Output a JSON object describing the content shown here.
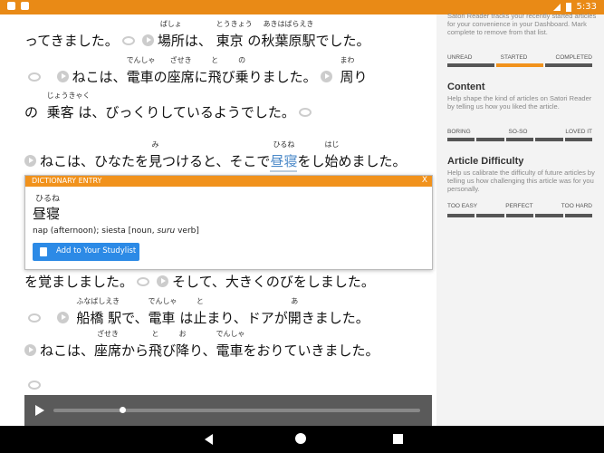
{
  "status": {
    "time": "5:33"
  },
  "lines": {
    "l1": {
      "a": "ってきました。",
      "b1": "場所",
      "b1r": "ばしょ",
      "c": "は、",
      "b2": "東京",
      "b2r": "とうきょう",
      "d": "の",
      "b3": "秋葉原駅",
      "b3r": "あきはばらえき",
      "e": "でした。"
    },
    "l2": {
      "a": "ねこは、",
      "b1": "電車",
      "b1r": "でんしゃ",
      "c": "の",
      "b2": "座席",
      "b2r": "ざせき",
      "d": "に",
      "b3": "飛",
      "b3r": "と",
      "e": "び",
      "b4": "乗",
      "b4r": "の",
      "f": "りました。",
      "b5": "周",
      "b5r": "まわ",
      "g": "り"
    },
    "l3": {
      "a": "の",
      "b1": "乗客",
      "b1r": "じょうきゃく",
      "c": "は、びっくりしているようでした。"
    },
    "l4": {
      "a": "ねこは、ひなたを",
      "b1": "見",
      "b1r": "み",
      "c": "つけると、そこで",
      "b2": "昼寝",
      "b2r": "ひるね",
      "d": "をし",
      "b3": "始",
      "b3r": "はじ",
      "e": "めました。"
    },
    "l5": {
      "a": "を覚ましました。",
      "b": "そして、大きくのびをしました。"
    },
    "l6": {
      "b1": "船橋",
      "b1r": "ふなばしえき",
      "a": "駅で、",
      "b2": "電車",
      "b2r": "でんしゃ",
      "c": "は",
      "b3": "止",
      "b3r": "と",
      "d": "まり、ドアが",
      "b4": "開",
      "b4r": "あ",
      "e": "きました。"
    },
    "l7": {
      "a": "ねこは、",
      "b1": "座席",
      "b1r": "ざせき",
      "c": "から",
      "b2": "飛",
      "b2r": "と",
      "d": "び",
      "b3": "降",
      "b3r": "お",
      "e": "り、",
      "b4": "電車",
      "b4r": "でんしゃ",
      "f": "をおりていきました。"
    }
  },
  "popup": {
    "title": "DICTIONARY ENTRY",
    "close": "X",
    "reading": "ひるね",
    "word": "昼寝",
    "definition_a": "nap (afternoon); siesta [noun, ",
    "definition_em": "suru",
    "definition_b": " verb]",
    "button": "Add to Your Studylist"
  },
  "sidebar": {
    "intro": "Satori Reader tracks your recently started articles for your convenience in your Dashboard. Mark complete to remove from that list.",
    "progress": {
      "labels": [
        "UNREAD",
        "STARTED",
        "COMPLETED"
      ],
      "selected": 1
    },
    "content": {
      "heading": "Content",
      "text": "Help shape the kind of articles on Satori Reader by telling us how you liked the article.",
      "labels": [
        "BORING",
        "SO-SO",
        "LOVED IT"
      ]
    },
    "difficulty": {
      "heading": "Article Difficulty",
      "text": "Help us calibrate the difficulty of future articles by telling us how challenging this article was for you personally.",
      "labels": [
        "TOO EASY",
        "PERFECT",
        "TOO HARD"
      ]
    }
  },
  "audio": {
    "progress": 0.18
  },
  "colors": {
    "accent": "#f1921c",
    "button": "#2c8ae6"
  }
}
